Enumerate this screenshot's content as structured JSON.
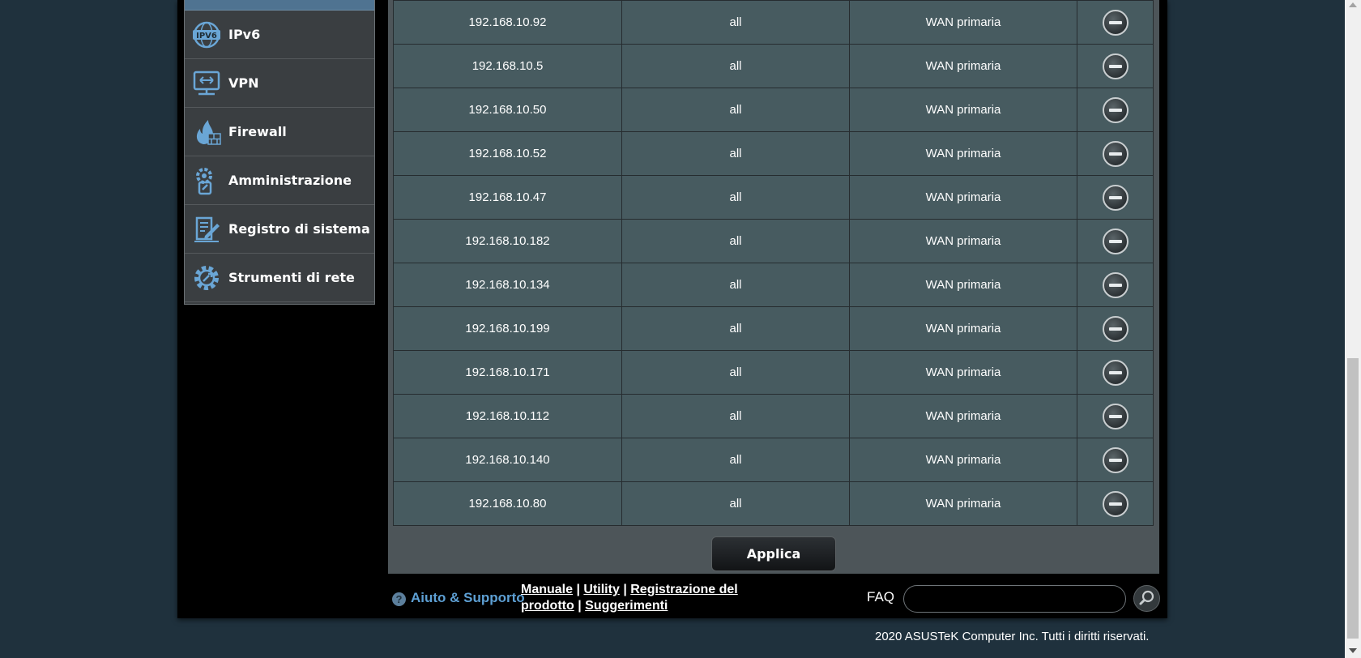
{
  "sidebar": {
    "items": [
      {
        "label": "IPv6",
        "icon": "ipv6-icon"
      },
      {
        "label": "VPN",
        "icon": "vpn-icon"
      },
      {
        "label": "Firewall",
        "icon": "firewall-icon"
      },
      {
        "label": "Amministrazione",
        "icon": "administration-icon"
      },
      {
        "label": "Registro di sistema",
        "icon": "system-log-icon"
      },
      {
        "label": "Strumenti di rete",
        "icon": "network-tools-icon"
      }
    ]
  },
  "rules_table": {
    "rows": [
      {
        "ip": "192.168.10.92",
        "dest": "all",
        "interface": "WAN primaria"
      },
      {
        "ip": "192.168.10.5",
        "dest": "all",
        "interface": "WAN primaria"
      },
      {
        "ip": "192.168.10.50",
        "dest": "all",
        "interface": "WAN primaria"
      },
      {
        "ip": "192.168.10.52",
        "dest": "all",
        "interface": "WAN primaria"
      },
      {
        "ip": "192.168.10.47",
        "dest": "all",
        "interface": "WAN primaria"
      },
      {
        "ip": "192.168.10.182",
        "dest": "all",
        "interface": "WAN primaria"
      },
      {
        "ip": "192.168.10.134",
        "dest": "all",
        "interface": "WAN primaria"
      },
      {
        "ip": "192.168.10.199",
        "dest": "all",
        "interface": "WAN primaria"
      },
      {
        "ip": "192.168.10.171",
        "dest": "all",
        "interface": "WAN primaria"
      },
      {
        "ip": "192.168.10.112",
        "dest": "all",
        "interface": "WAN primaria"
      },
      {
        "ip": "192.168.10.140",
        "dest": "all",
        "interface": "WAN primaria"
      },
      {
        "ip": "192.168.10.80",
        "dest": "all",
        "interface": "WAN primaria"
      }
    ]
  },
  "apply_label": "Applica",
  "footer": {
    "help_label": "Aiuto & Supporto",
    "links": {
      "manual": "Manuale",
      "utility": "Utility",
      "registration": "Registrazione del prodotto",
      "feedback": "Suggerimenti",
      "separator": "|"
    },
    "faq_label": "FAQ",
    "faq_value": "",
    "copyright": "2020 ASUSTeK Computer Inc. Tutti i diritti riservati."
  },
  "colors": {
    "page_bg": "#1f313d",
    "menu_bg": "#3a3e41",
    "table_cell_bg": "#475b60",
    "panel_bg": "#4d5559",
    "help_accent": "#5d9fd3"
  }
}
